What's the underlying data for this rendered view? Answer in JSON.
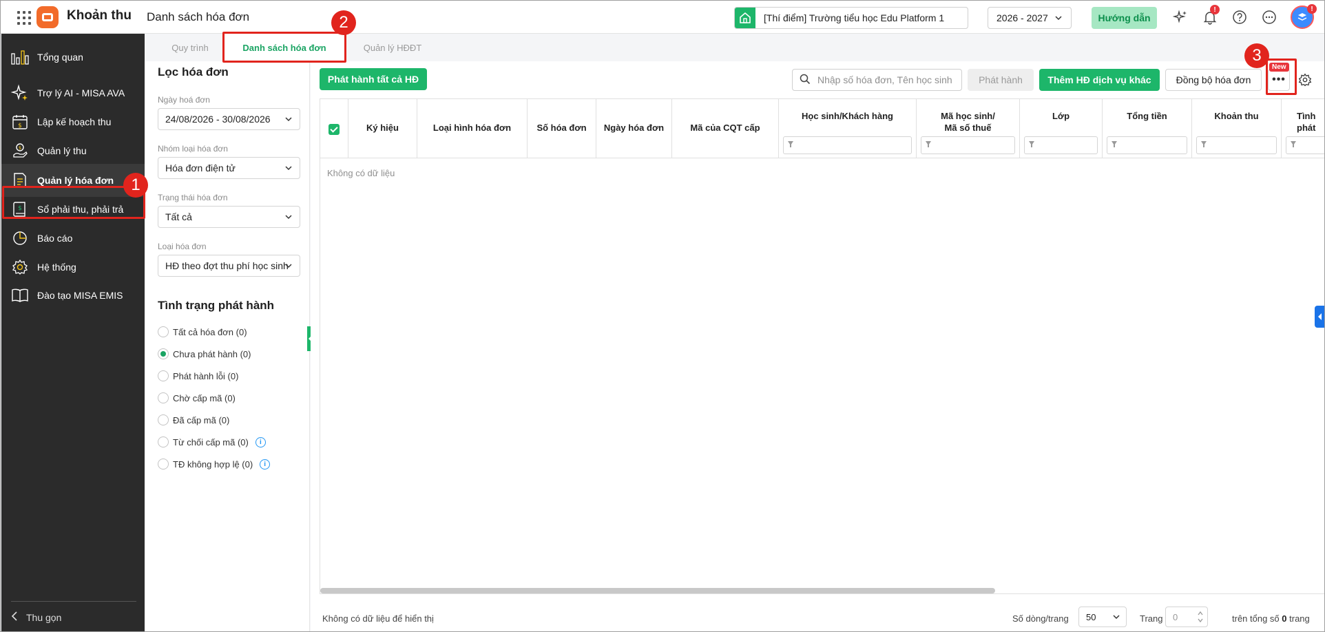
{
  "app": {
    "name": "Khoản thu",
    "page_title": "Danh sách hóa đơn"
  },
  "topbar": {
    "school": "[Thí điểm] Trường tiểu học Edu Platform 1",
    "year": "2026 - 2027",
    "guide_label": "Hướng dẫn",
    "notification_badge": "!",
    "avatar_badge": "!"
  },
  "sidebar": {
    "items": [
      {
        "label": "Tổng quan",
        "icon": "chart-bars-icon"
      },
      {
        "label": "Trợ lý AI - MISA AVA",
        "icon": "sparkle-icon"
      },
      {
        "label": "Lập kế hoạch thu",
        "icon": "calendar-dollar-icon"
      },
      {
        "label": "Quản lý thu",
        "icon": "hand-coin-icon"
      },
      {
        "label": "Quản lý hóa đơn",
        "icon": "invoice-icon"
      },
      {
        "label": "Sổ phải thu, phải trả",
        "icon": "ledger-icon"
      },
      {
        "label": "Báo cáo",
        "icon": "pie-chart-icon"
      },
      {
        "label": "Hệ thống",
        "icon": "gear-icon"
      },
      {
        "label": "Đào tạo MISA EMIS",
        "icon": "book-icon"
      }
    ],
    "active_index": 4,
    "collapse_label": "Thu gọn"
  },
  "tabs": [
    {
      "label": "Quy trình"
    },
    {
      "label": "Danh sách hóa đơn"
    },
    {
      "label": "Quản lý HĐĐT"
    }
  ],
  "filter": {
    "title": "Lọc hóa đơn",
    "date_label": "Ngày hoá đơn",
    "date_value": "24/08/2026 - 30/08/2026",
    "group_label": "Nhóm loại hóa đơn",
    "group_value": "Hóa đơn điện tử",
    "status_label": "Trạng thái hóa đơn",
    "status_value": "Tất cả",
    "type_label": "Loại hóa đơn",
    "type_value": "HĐ theo đợt thu phí học sinh",
    "release_heading": "Tình trạng phát hành",
    "release_options": [
      {
        "label": "Tất cả hóa đơn (0)"
      },
      {
        "label": "Chưa phát hành (0)"
      },
      {
        "label": "Phát hành lỗi (0)"
      },
      {
        "label": "Chờ cấp mã (0)"
      },
      {
        "label": "Đã cấp mã (0)"
      },
      {
        "label": "Từ chối cấp mã (0)"
      },
      {
        "label": "TĐ không hợp lệ (0)"
      }
    ],
    "release_selected": 1,
    "info_glyph": "i"
  },
  "toolbar": {
    "publish_all": "Phát hành tất cả HĐ",
    "search_placeholder": "Nhập số hóa đơn, Tên học sinh",
    "publish": "Phát hành",
    "add_other": "Thêm HĐ dịch vụ khác",
    "sync": "Đồng bộ hóa đơn",
    "more": "•••",
    "new_tag": "New"
  },
  "table": {
    "columns": [
      {
        "label": "Ký hiệu"
      },
      {
        "label": "Loại hình hóa đơn"
      },
      {
        "label": "Số hóa đơn"
      },
      {
        "label": "Ngày hóa đơn"
      },
      {
        "label": "Mã của CQT cấp"
      },
      {
        "label": "Học sinh/Khách hàng"
      },
      {
        "label": "Mã học sinh/"
      },
      {
        "label": "Mã số thuế"
      },
      {
        "label": "Lớp"
      },
      {
        "label": "Tổng tiền"
      },
      {
        "label": "Khoản thu"
      },
      {
        "label": "Tình"
      },
      {
        "label": "phát"
      }
    ],
    "empty_text": "Không có dữ liệu"
  },
  "footer": {
    "no_data": "Không có dữ liệu để hiển thị",
    "rows_label": "Số dòng/trang",
    "rows_value": "50",
    "page_label": "Trang",
    "page_value": "0",
    "total_prefix": "trên tổng số",
    "total_pages": "0",
    "total_suffix": "trang"
  },
  "annotations": {
    "m1": "1",
    "m2": "2",
    "m3": "3"
  },
  "colors": {
    "accent": "#1db66a",
    "highlight": "#e1241d",
    "sidebar": "#2b2b2b"
  }
}
